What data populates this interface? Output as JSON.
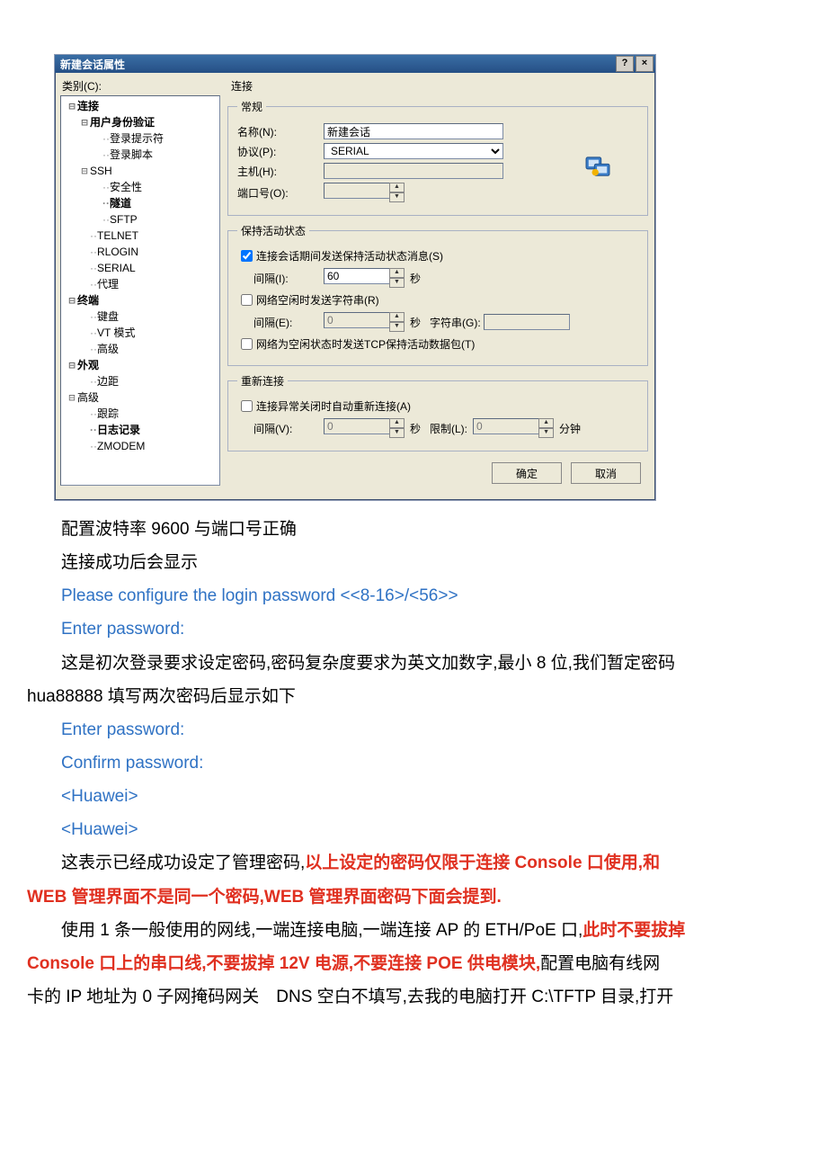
{
  "dialog": {
    "title": "新建会话属性",
    "help": "?",
    "close": "×",
    "category_label": "类别(C):",
    "tree": [
      {
        "lvl": 0,
        "tw": "⊟",
        "text": "连接",
        "bold": true
      },
      {
        "lvl": 1,
        "tw": "⊟",
        "text": "用户身份验证",
        "bold": true
      },
      {
        "lvl": 2,
        "tw": "",
        "text": "登录提示符"
      },
      {
        "lvl": 2,
        "tw": "",
        "text": "登录脚本"
      },
      {
        "lvl": 1,
        "tw": "⊟",
        "text": "SSH"
      },
      {
        "lvl": 2,
        "tw": "",
        "text": "安全性"
      },
      {
        "lvl": 2,
        "tw": "",
        "text": "隧道",
        "bold": true
      },
      {
        "lvl": 2,
        "tw": "",
        "text": "SFTP"
      },
      {
        "lvl": 1,
        "tw": "",
        "text": "TELNET"
      },
      {
        "lvl": 1,
        "tw": "",
        "text": "RLOGIN"
      },
      {
        "lvl": 1,
        "tw": "",
        "text": "SERIAL"
      },
      {
        "lvl": 1,
        "tw": "",
        "text": "代理"
      },
      {
        "lvl": 0,
        "tw": "⊟",
        "text": "终端",
        "bold": true
      },
      {
        "lvl": 1,
        "tw": "",
        "text": "键盘"
      },
      {
        "lvl": 1,
        "tw": "",
        "text": "VT 模式"
      },
      {
        "lvl": 1,
        "tw": "",
        "text": "高级"
      },
      {
        "lvl": 0,
        "tw": "⊟",
        "text": "外观",
        "bold": true
      },
      {
        "lvl": 1,
        "tw": "",
        "text": "边距"
      },
      {
        "lvl": 0,
        "tw": "⊟",
        "text": "高级"
      },
      {
        "lvl": 1,
        "tw": "",
        "text": "跟踪"
      },
      {
        "lvl": 1,
        "tw": "",
        "text": "日志记录",
        "bold": true
      },
      {
        "lvl": 1,
        "tw": "",
        "text": "ZMODEM"
      }
    ],
    "right_title": "连接",
    "general": {
      "legend": "常规",
      "name_label": "名称(N):",
      "name_value": "新建会话",
      "proto_label": "协议(P):",
      "proto_value": "SERIAL",
      "host_label": "主机(H):",
      "host_value": "",
      "port_label": "端口号(O):",
      "port_value": ""
    },
    "keepalive": {
      "legend": "保持活动状态",
      "chk1_label": "连接会话期间发送保持活动状态消息(S)",
      "chk1_checked": true,
      "interval1_label": "间隔(I):",
      "interval1_value": "60",
      "sec": "秒",
      "chk2_label": "网络空闲时发送字符串(R)",
      "interval2_label": "间隔(E):",
      "interval2_value": "0",
      "string_label": "字符串(G):",
      "string_value": "",
      "chk3_label": "网络为空闲状态时发送TCP保持活动数据包(T)"
    },
    "reconnect": {
      "legend": "重新连接",
      "chk_label": "连接异常关闭时自动重新连接(A)",
      "interval_label": "间隔(V):",
      "interval_value": "0",
      "sec": "秒",
      "limit_label": "限制(L):",
      "limit_value": "0",
      "min": "分钟"
    },
    "ok": "确定",
    "cancel": "取消"
  },
  "doc": {
    "l1": "配置波特率 9600 与端口号正确",
    "l2": "连接成功后会显示",
    "l3": "Please configure the login password <<8-16>/<56>>",
    "l4": "Enter password:",
    "l5a": "这是初次登录要求设定密码,密码复杂度要求为英文加数字,最小 8 位,我们暂定密码",
    "l5b": "hua88888 填写两次密码后显示如下",
    "l6": "Enter password:",
    "l7": "Confirm password:",
    "l8": "<Huawei>",
    "l9": "<Huawei>",
    "l10a": "这表示已经成功设定了管理密码,",
    "l10b": "以上设定的密码仅限于连接 Console 口使用,和",
    "l10c": "WEB 管理界面不是同一个密码,WEB 管理界面密码下面会提到.",
    "l11a": "使用 1 条一般使用的网线,一端连接电脑,一端连接 AP 的 ETH/PoE 口,",
    "l11b": "此时不要拔掉",
    "l11c": "Console 口上的串口线,不要拔掉 12V 电源,不要连接 POE 供电模块,",
    "l11d": "配置电脑有线网",
    "l11e": "卡的 IP 地址为 0 子网掩码网关　DNS 空白不填写,去我的电脑打开 C:\\TFTP 目录,打开"
  }
}
